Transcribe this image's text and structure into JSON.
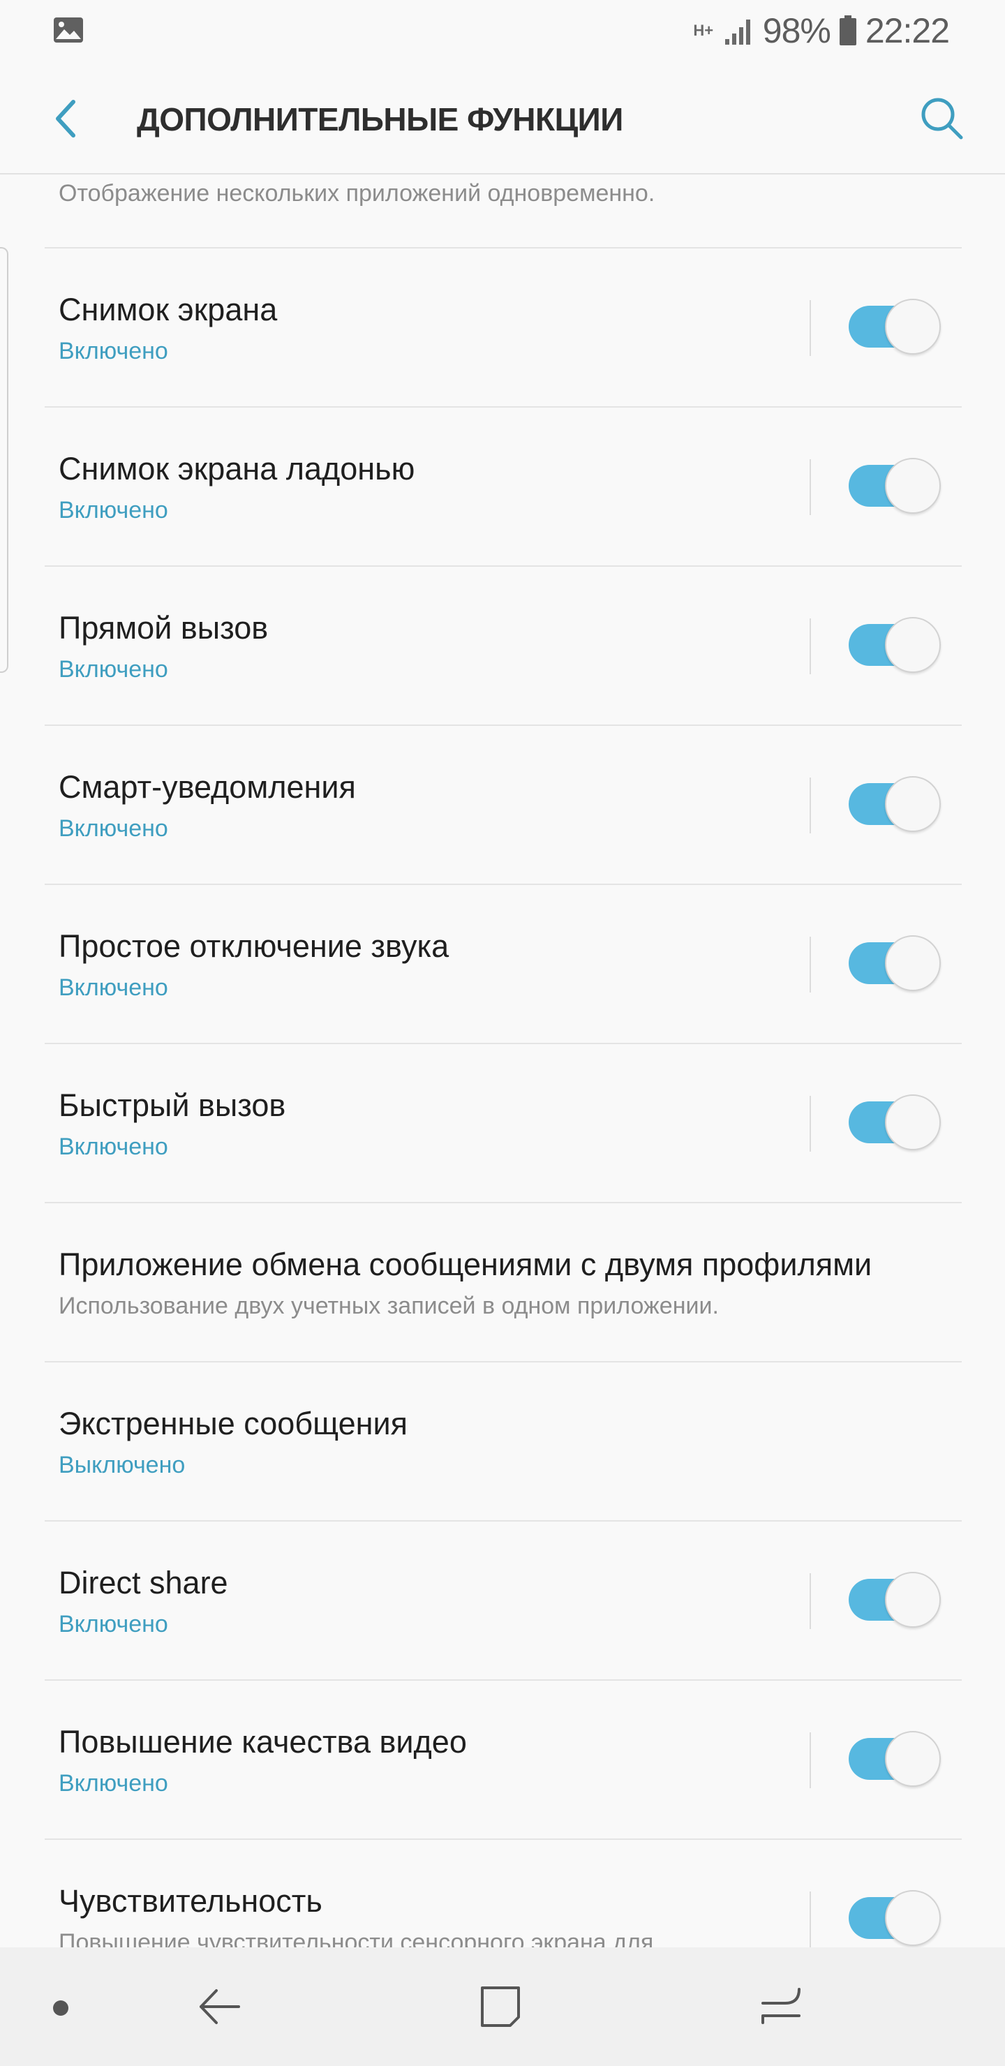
{
  "status_bar": {
    "network_type": "H+",
    "battery_percent": "98%",
    "time": "22:22",
    "icons": [
      "gallery-icon",
      "signal-icon",
      "battery-icon"
    ]
  },
  "header": {
    "title": "ДОПОЛНИТЕЛЬНЫЕ ФУНКЦИИ",
    "back_icon": "chevron-left-icon",
    "search_icon": "search-icon"
  },
  "partial_item": {
    "description": "Отображение нескольких приложений одновременно."
  },
  "settings": [
    {
      "title": "Снимок экрана",
      "subtitle": "Включено",
      "subtitle_kind": "status",
      "has_toggle": true,
      "toggle_on": true
    },
    {
      "title": "Снимок экрана ладонью",
      "subtitle": "Включено",
      "subtitle_kind": "status",
      "has_toggle": true,
      "toggle_on": true
    },
    {
      "title": "Прямой вызов",
      "subtitle": "Включено",
      "subtitle_kind": "status",
      "has_toggle": true,
      "toggle_on": true
    },
    {
      "title": "Смарт-уведомления",
      "subtitle": "Включено",
      "subtitle_kind": "status",
      "has_toggle": true,
      "toggle_on": true
    },
    {
      "title": "Простое отключение звука",
      "subtitle": "Включено",
      "subtitle_kind": "status",
      "has_toggle": true,
      "toggle_on": true
    },
    {
      "title": "Быстрый вызов",
      "subtitle": "Включено",
      "subtitle_kind": "status",
      "has_toggle": true,
      "toggle_on": true
    },
    {
      "title": "Приложение обмена сообщениями с двумя профилями",
      "subtitle": "Использование двух учетных записей в одном приложении.",
      "subtitle_kind": "desc",
      "has_toggle": false,
      "toggle_on": false
    },
    {
      "title": "Экстренные сообщения",
      "subtitle": "Выключено",
      "subtitle_kind": "status",
      "has_toggle": false,
      "toggle_on": false
    },
    {
      "title": "Direct share",
      "subtitle": "Включено",
      "subtitle_kind": "status",
      "has_toggle": true,
      "toggle_on": true
    },
    {
      "title": "Повышение качества видео",
      "subtitle": "Включено",
      "subtitle_kind": "status",
      "has_toggle": true,
      "toggle_on": true
    },
    {
      "title": "Чувствительность",
      "subtitle": "Повышение чувствительности сенсорного экрана для",
      "subtitle_kind": "desc",
      "has_toggle": true,
      "toggle_on": true
    }
  ],
  "nav_bar": {
    "icons": [
      "dot-icon",
      "back-arrow-icon",
      "home-square-icon",
      "recents-icon"
    ]
  },
  "colors": {
    "accent": "#3f9ec0",
    "toggle_track": "#57b8e0",
    "background": "#f9f9f9",
    "nav_background": "#f0f0f0"
  }
}
